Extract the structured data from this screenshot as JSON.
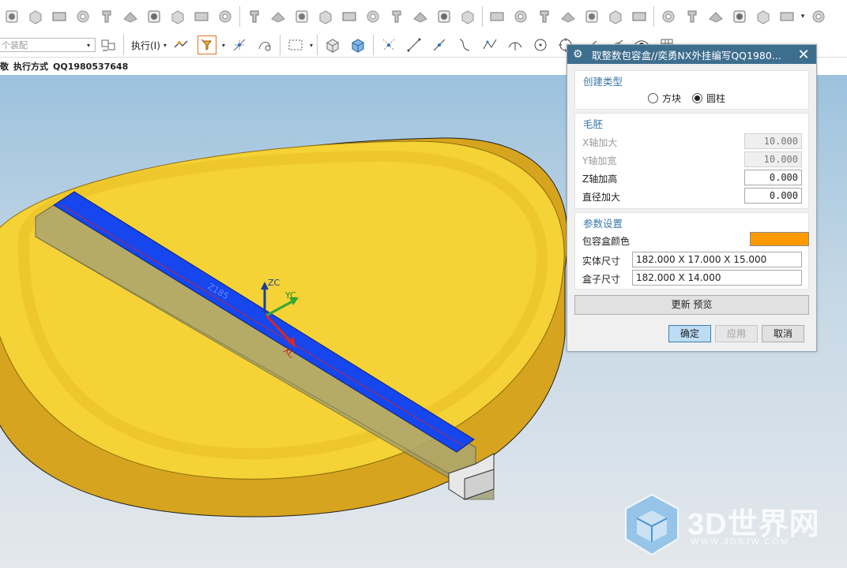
{
  "toolbar_top": {
    "icons": [
      "hole-icon",
      "face-icon",
      "block-icon",
      "wave-text-icon",
      "pattern-icon",
      "chamfer-icon",
      "box-icon",
      "grid-holes-icon",
      "nut-icon",
      "bolt-icon",
      "pin-icon",
      "punch-icon",
      "stamp-icon",
      "plate-icon",
      "i-beam-icon",
      "tee-icon",
      "spring-plate-icon",
      "bracket-icon",
      "lever-icon",
      "clamp-icon",
      "step-icon",
      "table-icon",
      "cylinder-icon",
      "cylinder-pair-icon",
      "stack-icon",
      "slab-icon",
      "rod-icon",
      "screw-icon",
      "texture-icon",
      "column-icon",
      "shelf-icon",
      "coil-icon",
      "disc-icon",
      "cable-icon"
    ],
    "more_glyph": "▾"
  },
  "toolbar_second": {
    "selection_filter_placeholder": "个装配",
    "execute_label": "执行(I)",
    "caret": "▾"
  },
  "status_line": {
    "prefix": "敬",
    "mode_label": "执行方式",
    "contact": "QQ1980537648"
  },
  "viewport": {
    "axes": {
      "zc": "ZC",
      "yc": "YC",
      "xc": "XC"
    },
    "part_text": "Z185"
  },
  "watermark": {
    "text": "3D世界网",
    "url": "WWW.3DSJW.COM"
  },
  "dialog": {
    "title": "取整数包容盒//奕勇NX外挂编写QQ1980...",
    "gear_glyph": "⚙",
    "close_glyph": "✕",
    "create_type": {
      "title": "创建类型",
      "options": [
        {
          "label": "方块",
          "selected": false
        },
        {
          "label": "圆柱",
          "selected": true
        }
      ]
    },
    "blank": {
      "title": "毛胚",
      "x_label": "X轴加大",
      "x_value": "10.000",
      "y_label": "Y轴加宽",
      "y_value": "10.000",
      "z_label": "Z轴加高",
      "z_value": "0.000",
      "d_label": "直径加大",
      "d_value": "0.000"
    },
    "params": {
      "title": "参数设置",
      "color_label": "包容盒颜色",
      "color": "#ff9900",
      "solid_label": "实体尺寸",
      "solid_value": "182.000 X 17.000 X 15.000",
      "box_label": "盒子尺寸",
      "box_value": "182.000 X 14.000"
    },
    "update_label": "更新  预览",
    "ok_label": "确定",
    "apply_label": "应用",
    "cancel_label": "取消"
  },
  "colors": {
    "cylinder_top": "#f5d235",
    "cylinder_side": "#d8a81e",
    "bar_top": "#1646ee",
    "bar_side": "#c2a23a",
    "title_bar": "#3e6e8e",
    "accent_blue": "#3a77a8"
  }
}
